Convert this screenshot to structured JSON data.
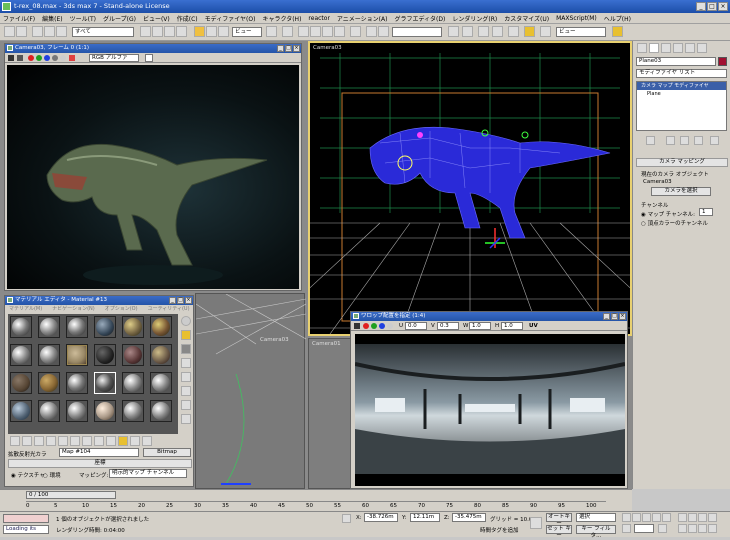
{
  "window": {
    "title": "t-rex_08.max - 3ds max 7 - Stand-alone License"
  },
  "menu": [
    "ファイル(F)",
    "編集(E)",
    "ツール(T)",
    "グループ(G)",
    "ビュー(V)",
    "作成(C)",
    "モディファイヤ(O)",
    "キャラクタ(H)",
    "reactor",
    "アニメーション(A)",
    "グラフエディタ(D)",
    "レンダリング(R)",
    "カスタマイズ(U)",
    "MAXScript(M)",
    "ヘルプ(H)"
  ],
  "toolbar": {
    "selection_filter": "すべて",
    "ref_coord": "ビュー",
    "named_selection": "",
    "view_dropdown": "ビュー"
  },
  "frame_window": {
    "title": "Camera03, フレーム 0 (1:1)",
    "channel": "RGB アルファ"
  },
  "viewports": {
    "camera03": "Camera03",
    "bottom_left": "Camera03",
    "bottom_middle": "Camera01"
  },
  "material_editor": {
    "title": "マテリアル エディタ - Material #13",
    "menu": [
      "マテリアル(M)",
      "ナビゲーション(N)",
      "オプション(O)",
      "ユーティリティ(U)"
    ],
    "map_label": "拡散反射光カラ",
    "map_name": "Map #104",
    "map_type": "Bitmap",
    "rollout": "座標",
    "texture_radio": "テクスチャ",
    "env_radio": "環境",
    "mapping_label": "マッピング:",
    "mapping_value": "明示的マップ チャンネル"
  },
  "env_map_window": {
    "title": "ワロップ配置を指定 (1:4)",
    "u_label": "U",
    "u_value": "0.0",
    "v_label": "V",
    "v_value": "0.3",
    "w_label": "W",
    "w_value": "1.0",
    "h_label": "H",
    "h_value": "1.0",
    "uv": "UV"
  },
  "command_panel": {
    "object_name": "Plane03",
    "modifier_list": "モディファイヤ リスト",
    "stack": [
      "カメラ マップ モディファイヤ",
      "Plane"
    ],
    "rollout_title": "カメラ マッピング",
    "current_camera_label": "現在のカメラ オブジェクト",
    "camera_name": "Camera03",
    "pick_camera": "カメラを選択",
    "channel_group": "チャンネル",
    "map_channel_label": "マップ チャンネル:",
    "map_channel_value": "1",
    "vertex_color": "頂点カラーのチャンネル"
  },
  "timeline": {
    "frame_indicator": "0 / 100",
    "ticks": [
      "0",
      "5",
      "10",
      "15",
      "20",
      "25",
      "30",
      "35",
      "40",
      "45",
      "50",
      "55",
      "60",
      "65",
      "70",
      "75",
      "80",
      "85",
      "90",
      "95",
      "100"
    ]
  },
  "status": {
    "script_box": "Loading its",
    "selection_msg": "1 個のオブジェクトが選択されました",
    "render_time": "レンダリング時間: 0:04:00",
    "x_label": "X:",
    "x_value": "-38.726m",
    "y_label": "Y:",
    "y_value": "12.11m",
    "z_label": "Z:",
    "z_value": "-35.475m",
    "grid": "グリッド = 10.0m",
    "add_time_tag": "時間タグを追加",
    "autokey": "オートキー",
    "autokey_value": "選択",
    "setkey": "セット キー",
    "key_filter": "キー フィルタ..."
  }
}
